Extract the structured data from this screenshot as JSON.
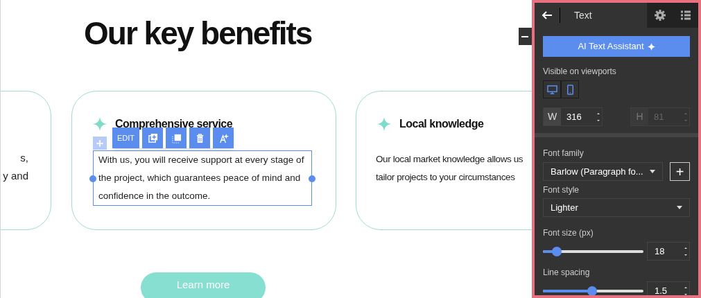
{
  "page": {
    "heading": "Our key benefits",
    "cards": [
      {
        "kind": "partial",
        "lines": [
          "s,",
          "y and"
        ]
      },
      {
        "kind": "selected",
        "title": "Comprehensive service",
        "body": "With us, you will receive support at every stage of the project, which guarantees peace of mind and confidence in the outcome."
      },
      {
        "kind": "plain",
        "title": "Local knowledge",
        "lines": [
          "Our local market knowledge allows us",
          "tailor projects to your circumstances"
        ]
      }
    ],
    "toolbar": {
      "edit_label": "EDIT"
    },
    "button": "Learn more"
  },
  "panel": {
    "title": "Text",
    "tabs": [
      {
        "kind": "settings",
        "selected": false
      },
      {
        "kind": "list",
        "selected": false
      }
    ],
    "ai_button": "AI Text Assistant",
    "viewports": {
      "label": "Visible on viewports",
      "items": [
        {
          "kind": "desktop",
          "on": true
        },
        {
          "kind": "mobile",
          "on": true
        }
      ]
    },
    "size": [
      {
        "label": "W",
        "value": "316",
        "disabled": false
      },
      {
        "label": "H",
        "value": "81",
        "disabled": true
      }
    ],
    "font_family": {
      "label": "Font family",
      "value": "Barlow (Paragraph fo..."
    },
    "add_font": "+",
    "font_style": {
      "label": "Font style",
      "value": "Lighter"
    },
    "sliders": [
      {
        "label": "Font size (px)",
        "level": 0.1,
        "value": "18"
      },
      {
        "label": "Line spacing",
        "level": 0.49,
        "value": "1.5"
      }
    ]
  }
}
